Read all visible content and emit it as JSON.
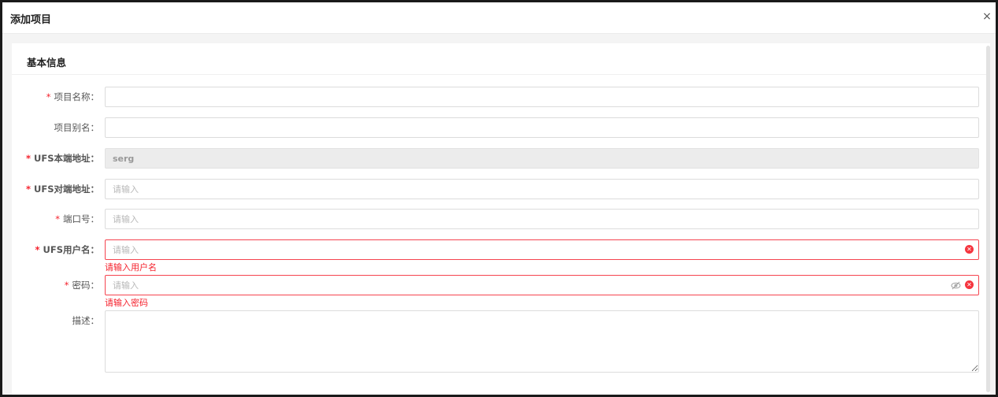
{
  "dialog": {
    "title": "添加项目",
    "close_glyph": "×"
  },
  "section": {
    "title": "基本信息"
  },
  "required_mark": "*",
  "fields": {
    "project_name": {
      "label": "项目名称：",
      "value": "",
      "placeholder": ""
    },
    "project_alias": {
      "label": "项目别名：",
      "value": "",
      "placeholder": ""
    },
    "ufs_local_addr": {
      "label": "UFS本端地址：",
      "value": "serg"
    },
    "ufs_peer_addr": {
      "label": "UFS对端地址：",
      "placeholder": "请输入"
    },
    "port": {
      "label": "端口号：",
      "placeholder": "请输入"
    },
    "ufs_username": {
      "label": "UFS用户名：",
      "placeholder": "请输入",
      "error": "请输入用户名"
    },
    "password": {
      "label": "密码：",
      "placeholder": "请输入",
      "error": "请输入密码"
    },
    "description": {
      "label": "描述：",
      "placeholder": ""
    }
  },
  "icons": {
    "close": "close-icon",
    "clear": "clear-circle-icon",
    "eye": "eye-hidden-icon"
  },
  "colors": {
    "error": "#f5222d",
    "required": "#f5222d"
  }
}
